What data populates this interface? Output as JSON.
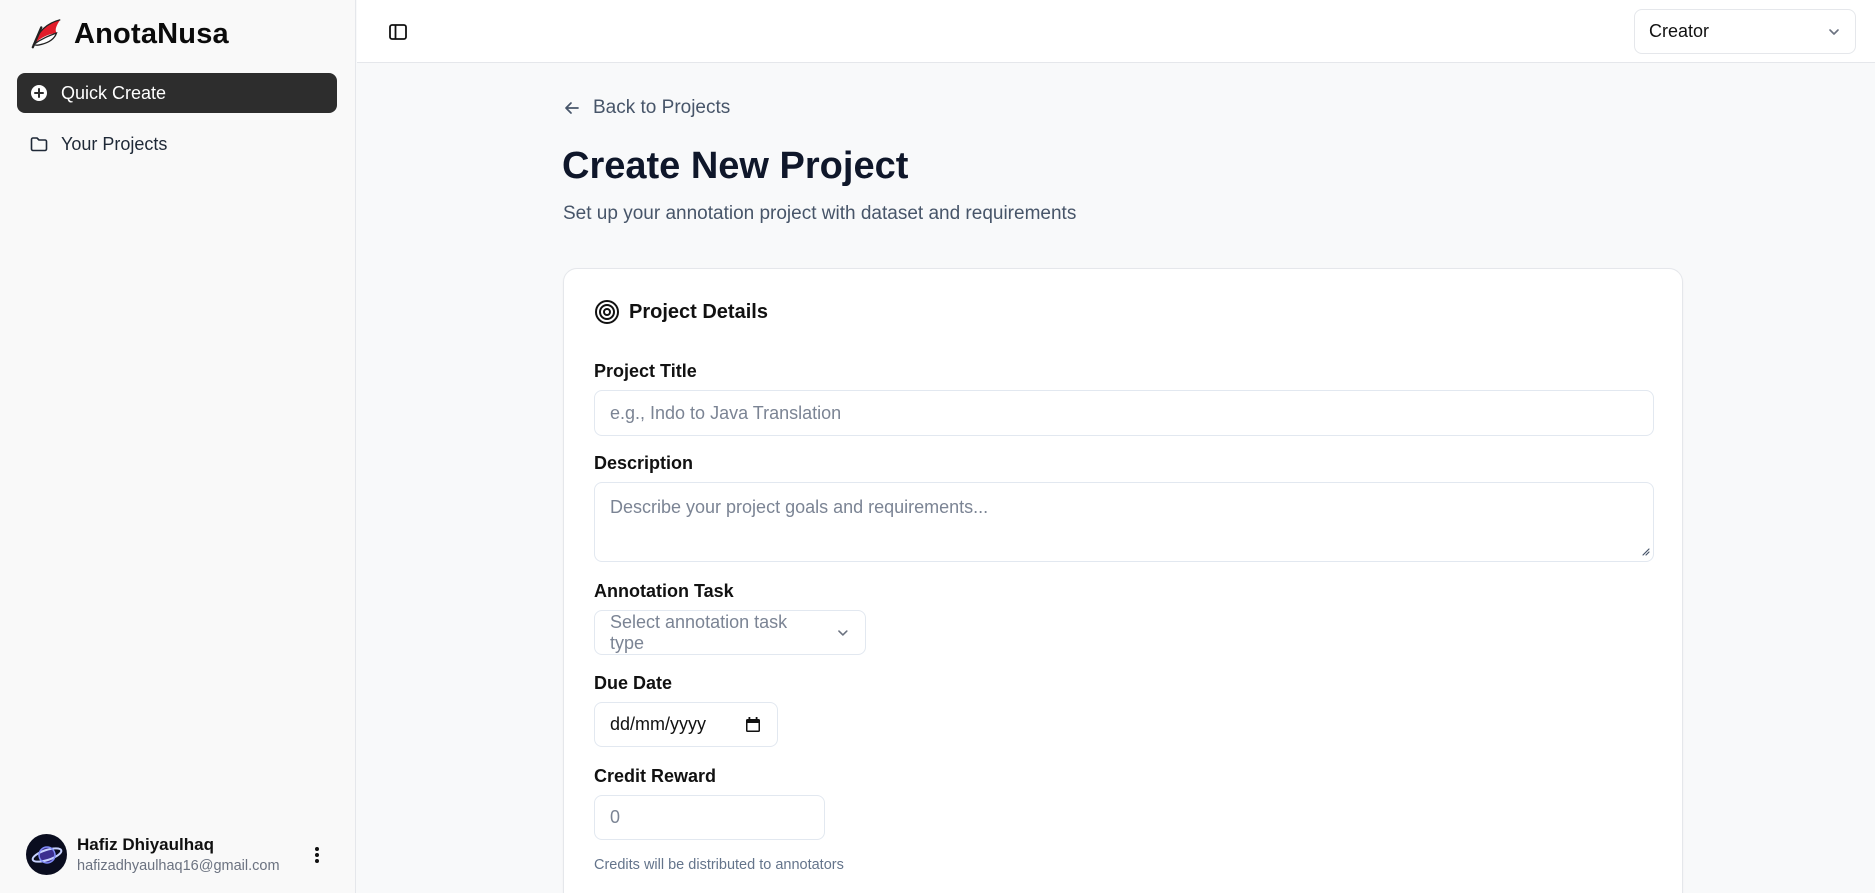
{
  "brand": {
    "name": "AnotaNusa"
  },
  "sidebar": {
    "items": [
      {
        "label": "Quick Create",
        "icon": "plus-circle-icon",
        "active": true
      },
      {
        "label": "Your Projects",
        "icon": "folder-icon",
        "active": false
      }
    ]
  },
  "user": {
    "name": "Hafiz Dhiyaulhaq",
    "email": "hafizadhyaulhaq16@gmail.com"
  },
  "topbar": {
    "role": "Creator"
  },
  "main": {
    "back_label": "Back to Projects",
    "title": "Create New Project",
    "subtitle": "Set up your annotation project with dataset and requirements"
  },
  "form": {
    "section_title": "Project Details",
    "project_title": {
      "label": "Project Title",
      "placeholder": "e.g., Indo to Java Translation",
      "value": ""
    },
    "description": {
      "label": "Description",
      "placeholder": "Describe your project goals and requirements...",
      "value": ""
    },
    "annotation_task": {
      "label": "Annotation Task",
      "placeholder": "Select annotation task type"
    },
    "due_date": {
      "label": "Due Date",
      "value": "dd/mm/yyyy"
    },
    "credit_reward": {
      "label": "Credit Reward",
      "placeholder": "0",
      "helper": "Credits will be distributed to annotators"
    }
  },
  "colors": {
    "accent": "#2d2d2d",
    "background": "#f8f9fa",
    "border": "#e5e7eb",
    "muted_text": "#475569",
    "flag_red": "#e11d2a"
  }
}
